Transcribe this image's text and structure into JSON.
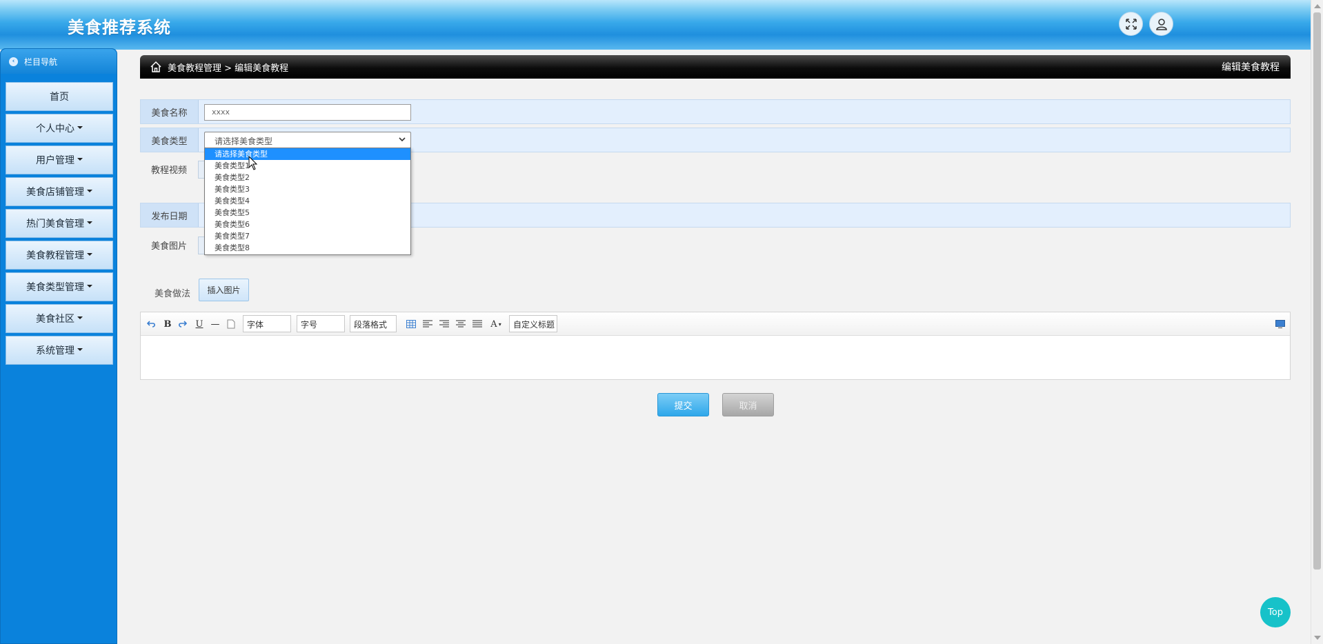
{
  "app": {
    "title": "美食推荐系统"
  },
  "header": {
    "fullscreen_icon": "fullscreen-icon",
    "user_icon": "user-icon"
  },
  "sidebar": {
    "heading": "栏目导航",
    "items": [
      {
        "label": "首页",
        "has_caret": false
      },
      {
        "label": "个人中心",
        "has_caret": true
      },
      {
        "label": "用户管理",
        "has_caret": true
      },
      {
        "label": "美食店铺管理",
        "has_caret": true
      },
      {
        "label": "热门美食管理",
        "has_caret": true
      },
      {
        "label": "美食教程管理",
        "has_caret": true
      },
      {
        "label": "美食类型管理",
        "has_caret": true
      },
      {
        "label": "美食社区",
        "has_caret": true
      },
      {
        "label": "系统管理",
        "has_caret": true
      }
    ]
  },
  "breadcrumb": {
    "path": "美食教程管理 > 编辑美食教程",
    "right": "编辑美食教程"
  },
  "form": {
    "name_label": "美食名称",
    "name_value": "xxxx",
    "type_label": "美食类型",
    "type_selected": "请选择美食类型",
    "type_options": [
      "请选择美食类型",
      "美食类型1",
      "美食类型2",
      "美食类型3",
      "美食类型4",
      "美食类型5",
      "美食类型6",
      "美食类型7",
      "美食类型8"
    ],
    "video_label": "教程视频",
    "date_label": "发布日期",
    "image_label": "美食图片",
    "method_label": "美食做法",
    "insert_image": "插入图片"
  },
  "editor": {
    "font_combo": "字体",
    "size_combo": "字号",
    "paragraph_combo": "段落格式",
    "custom_title_combo": "自定义标题"
  },
  "actions": {
    "submit": "提交",
    "cancel": "取消"
  },
  "top_button": "Top",
  "colors": {
    "sidebar": "#0a82dc",
    "accent": "#2ea7ea",
    "top": "#17c2c9",
    "selected_option": "#1e90ff"
  }
}
